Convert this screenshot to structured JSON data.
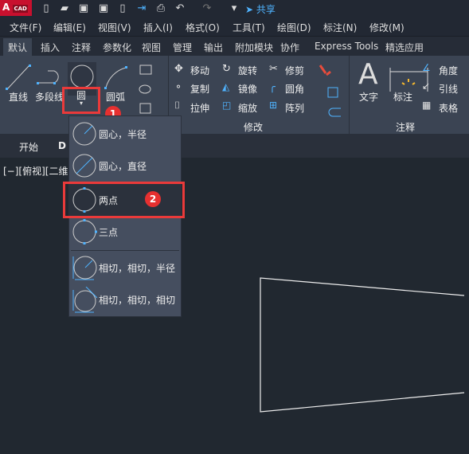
{
  "app": {
    "logo": "A",
    "logo_sub": "CAD",
    "share": "共享"
  },
  "quick_access": [
    {
      "icon": "new-file-icon"
    },
    {
      "icon": "open-folder-icon"
    },
    {
      "icon": "save-icon"
    },
    {
      "icon": "save-as-icon"
    },
    {
      "icon": "open-device-icon"
    },
    {
      "icon": "import-icon"
    },
    {
      "icon": "print-icon"
    },
    {
      "icon": "undo-icon"
    },
    {
      "icon": "redo-icon"
    },
    {
      "icon": "customize-icon"
    }
  ],
  "menu": [
    "文件(F)",
    "编辑(E)",
    "视图(V)",
    "插入(I)",
    "格式(O)",
    "工具(T)",
    "绘图(D)",
    "标注(N)",
    "修改(M)"
  ],
  "ribbon_tabs": [
    "默认",
    "插入",
    "注释",
    "参数化",
    "视图",
    "管理",
    "输出",
    "附加模块",
    "协作",
    "Express Tools",
    "精选应用"
  ],
  "draw": {
    "line": "直线",
    "polyline": "多段线",
    "circle": "圆",
    "arc": "圆弧"
  },
  "modify": {
    "title": "修改",
    "move": "移动",
    "rotate": "旋转",
    "trim": "修剪",
    "copy": "复制",
    "mirror": "镜像",
    "fillet": "圆角",
    "stretch": "拉伸",
    "scale": "缩放",
    "array": "阵列"
  },
  "annotation": {
    "title": "注释",
    "text": "文字",
    "dimension": "标注",
    "angle": "角度",
    "leader": "引线",
    "table": "表格"
  },
  "doc_tabs": {
    "start": "开始",
    "current": "D"
  },
  "viewport_label": "[−][俯视][二维",
  "circle_menu": [
    "圆心，半径",
    "圆心，直径",
    "两点",
    "三点",
    "相切，相切，半径",
    "相切，相切，相切"
  ],
  "callouts": [
    "1",
    "2"
  ],
  "colors": {
    "accent": "#4fb3ff",
    "highlight": "#ea3a3a",
    "ribbon": "#3b4453",
    "canvas": "#212830"
  }
}
